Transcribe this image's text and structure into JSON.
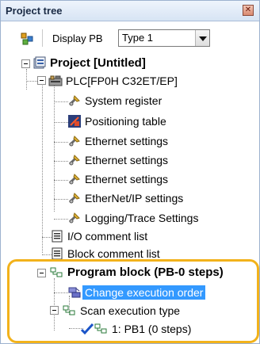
{
  "panel": {
    "title": "Project tree",
    "close_glyph": "✕"
  },
  "toolbar": {
    "display_pb_label": "Display PB",
    "type_value": "Type 1"
  },
  "tree": {
    "project": "Project [Untitled]",
    "plc": "PLC[FP0H C32ET/EP]",
    "plc_children": [
      "System register",
      "Positioning table",
      "Ethernet settings",
      "Ethernet settings",
      "Ethernet settings",
      "EtherNet/IP settings",
      "Logging/Trace Settings"
    ],
    "io_comment": "I/O comment list",
    "block_comment": "Block comment list",
    "program_block": "Program block (PB-0 steps)",
    "change_order": "Change execution order",
    "scan_type": "Scan execution type",
    "pb1": "1: PB1 (0 steps)"
  },
  "colors": {
    "highlight": "#f2b21b",
    "selection": "#3399ff",
    "title_bg": "#d7e4f4"
  }
}
